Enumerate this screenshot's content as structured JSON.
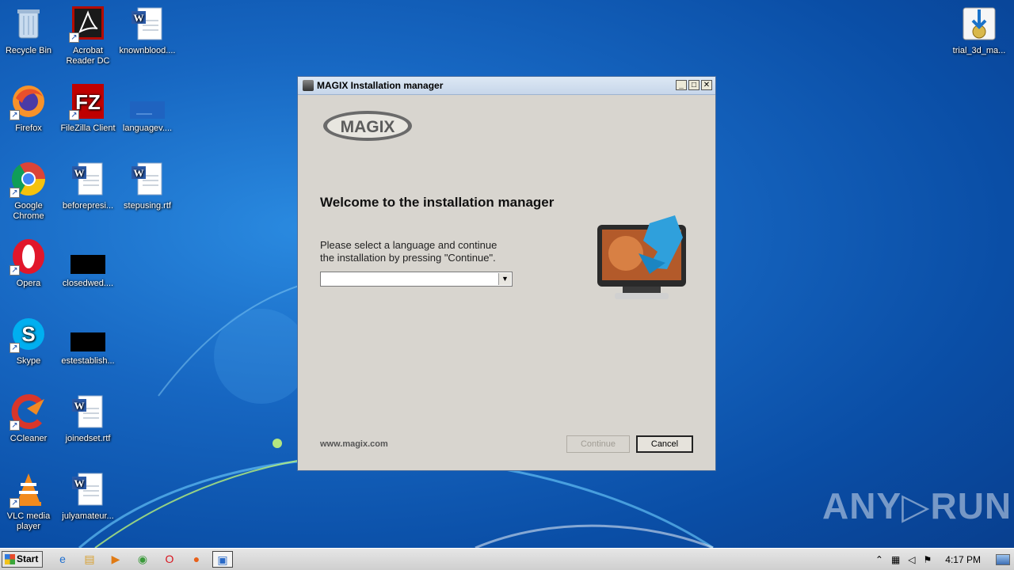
{
  "desktop": {
    "icons": [
      {
        "label": "Recycle Bin"
      },
      {
        "label": "Acrobat Reader DC"
      },
      {
        "label": "knownblood...."
      },
      {
        "label": "Firefox"
      },
      {
        "label": "FileZilla Client"
      },
      {
        "label": "languagev...."
      },
      {
        "label": "Google Chrome"
      },
      {
        "label": "beforepresi..."
      },
      {
        "label": "stepusing.rtf"
      },
      {
        "label": "Opera"
      },
      {
        "label": "closedwed...."
      },
      {
        "label": "Skype"
      },
      {
        "label": "estestablish..."
      },
      {
        "label": "CCleaner"
      },
      {
        "label": "joinedset.rtf"
      },
      {
        "label": "VLC media player"
      },
      {
        "label": "julyamateur..."
      },
      {
        "label": "trial_3d_ma..."
      }
    ]
  },
  "window": {
    "title": "MAGIX Installation manager",
    "logo_text": "MAGIX",
    "heading": "Welcome to the installation manager",
    "instruction_line1": "Please select a language and continue",
    "instruction_line2": "the installation by pressing \"Continue\".",
    "language_select_value": "",
    "url": "www.magix.com",
    "continue_label": "Continue",
    "cancel_label": "Cancel",
    "minimize_glyph": "_",
    "maximize_glyph": "□",
    "close_glyph": "✕"
  },
  "watermark": "ANY▷RUN",
  "taskbar": {
    "start_label": "Start",
    "clock": "4:17 PM"
  }
}
